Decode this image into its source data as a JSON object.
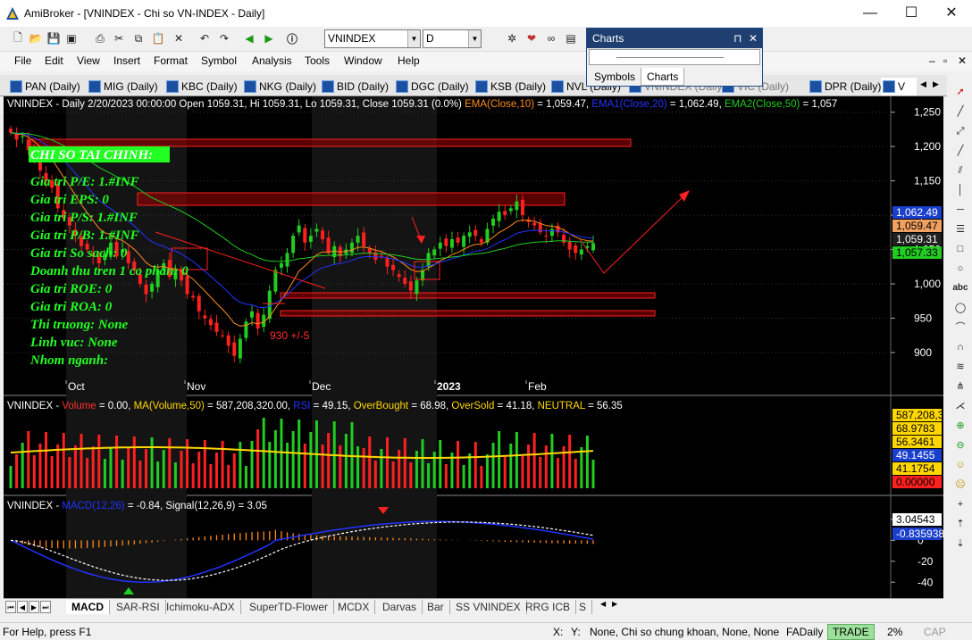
{
  "window": {
    "title": "AmiBroker - [VNINDEX - Chi so VN-INDEX - Daily]",
    "minimize": "—",
    "maximize": "☐",
    "close": "✕"
  },
  "toolbar": {
    "symbol": "VNINDEX",
    "interval": "D"
  },
  "menu": [
    "File",
    "Edit",
    "View",
    "Insert",
    "Format",
    "Symbol",
    "Analysis",
    "Tools",
    "Window",
    "Help"
  ],
  "mdi_controls": [
    "–",
    "▫",
    "✕"
  ],
  "chart_tabs": [
    "PAN (Daily)",
    "MIG (Daily)",
    "KBC (Daily)",
    "NKG (Daily)",
    "BID (Daily)",
    "DGC (Daily)",
    "KSB (Daily)",
    "NVL (Daily)",
    "VNINDEX (Daily)",
    "VIC (Daily)",
    "DPR (Daily)",
    "V"
  ],
  "charts_panel": {
    "title": "Charts",
    "pin": "⊓",
    "close": "✕",
    "tabs": [
      "Symbols",
      "Charts"
    ],
    "active_tab": "Charts"
  },
  "price_pane": {
    "header_segments": [
      {
        "text": "VNINDEX - Daily 2/20/2023 00:00:00 Open 1059.31, Hi 1059.31, Lo 1059.31, Close 1059.31 (0.0%) ",
        "color": "#ffffff"
      },
      {
        "text": "EMA(Close,10)",
        "color": "#ff8c1a"
      },
      {
        "text": " = 1,059.47, ",
        "color": "#ffffff"
      },
      {
        "text": "EMA1(Close,20)",
        "color": "#2233ff"
      },
      {
        "text": " = 1,062.49, ",
        "color": "#ffffff"
      },
      {
        "text": "EMA2(Close,50)",
        "color": "#22cc22"
      },
      {
        "text": " = 1,057",
        "color": "#ffffff"
      }
    ],
    "fundamentals_title": "CHI SO TAI CHINH:",
    "fundamentals": [
      "Gia tri P/E: 1.#INF",
      "Gia tri EPS: 0",
      "Gia tri P/S: 1.#INF",
      "Gia tri P/B: 1.#INF",
      "Gia tri So sach: 0",
      "Doanh thu tren 1 co phan: 0",
      "Gia tri ROE: 0",
      "Gia tri ROA: 0",
      "Thi truong: None",
      "Linh vuc: None",
      "Nhom nganh:"
    ],
    "annotation": "930 +/-5",
    "y_ticks": [
      "1,250",
      "1,200",
      "1,150",
      "1,100",
      "1,050",
      "1,000",
      "950",
      "900"
    ],
    "x_ticks": [
      "Oct",
      "Nov",
      "Dec",
      "2023",
      "Feb"
    ],
    "value_boxes": [
      {
        "text": "1,062.49",
        "bg": "#1a3fcc",
        "fg": "#ffffff"
      },
      {
        "text": "1,059.47",
        "bg": "#f0a060",
        "fg": "#000000"
      },
      {
        "text": "1,059.31",
        "bg": "#202020",
        "fg": "#ffffff"
      },
      {
        "text": "1,057.33",
        "bg": "#22cc22",
        "fg": "#000000"
      }
    ]
  },
  "volume_pane": {
    "header_segments": [
      {
        "text": "VNINDEX - ",
        "color": "#ffffff"
      },
      {
        "text": "Volume",
        "color": "#ff3030"
      },
      {
        "text": " = 0.00, ",
        "color": "#ffffff"
      },
      {
        "text": "MA(Volume,50)",
        "color": "#ffd700"
      },
      {
        "text": " = 587,208,320.00, ",
        "color": "#ffffff"
      },
      {
        "text": "RSI",
        "color": "#2233ff"
      },
      {
        "text": " = 49.15, ",
        "color": "#ffffff"
      },
      {
        "text": "OverBought",
        "color": "#ffd700"
      },
      {
        "text": " = 68.98, ",
        "color": "#ffffff"
      },
      {
        "text": "OverSold",
        "color": "#ffd700"
      },
      {
        "text": " = 41.18, ",
        "color": "#ffffff"
      },
      {
        "text": "NEUTRAL",
        "color": "#ffd700"
      },
      {
        "text": " = 56.35",
        "color": "#ffffff"
      }
    ],
    "value_boxes": [
      {
        "text": "587,208,3",
        "bg": "#ffd700",
        "fg": "#000000"
      },
      {
        "text": "68.9783",
        "bg": "#ffd700",
        "fg": "#000000"
      },
      {
        "text": "56.3461",
        "bg": "#ffd700",
        "fg": "#000000"
      },
      {
        "text": "49.1455",
        "bg": "#1a3fcc",
        "fg": "#ffffff"
      },
      {
        "text": "41.1754",
        "bg": "#ffd700",
        "fg": "#000000"
      },
      {
        "text": "0.00000",
        "bg": "#ff2020",
        "fg": "#000000"
      }
    ]
  },
  "macd_pane": {
    "header_segments": [
      {
        "text": "VNINDEX - ",
        "color": "#ffffff"
      },
      {
        "text": "MACD(12,26)",
        "color": "#2233ff"
      },
      {
        "text": " = -0.84, Signal(12,26,9) = 3.05",
        "color": "#ffffff"
      }
    ],
    "y_ticks": [
      "20",
      "0",
      "-20",
      "-40"
    ],
    "value_boxes": [
      {
        "text": "3.04543",
        "bg": "#ffffff",
        "fg": "#000000"
      },
      {
        "text": "-0.835938",
        "bg": "#1a3fcc",
        "fg": "#ffffff"
      }
    ]
  },
  "sheet_tabs": [
    "MACD",
    "SAR-RSI",
    "Ichimoku-ADX",
    "SuperTD-Flower",
    "MCDX",
    "Darvas",
    "Bar",
    "SS VNINDEX",
    "RRG ICB",
    "S"
  ],
  "active_sheet": "MACD",
  "status": {
    "help": "For Help, press F1",
    "x": "X:",
    "y": "Y:",
    "info": "None, Chi so chung khoan, None, None",
    "db": "FADaily",
    "mode": "TRADE",
    "pct": "2%",
    "cap": "CAP"
  },
  "colors": {
    "chart_bg": "#000000",
    "up_candle": "#22cc22",
    "down_candle": "#ff2020",
    "ema10": "#ff8c1a",
    "ema20": "#2233ff",
    "ema50": "#22cc22",
    "fund_text": "#22ff22",
    "grid": "#333333"
  },
  "chart_data": [
    {
      "type": "candlestick",
      "title": "VNINDEX - Daily",
      "x_ticks": [
        "Oct",
        "Nov",
        "Dec",
        "2023",
        "Feb"
      ],
      "ylim": [
        870,
        1260
      ],
      "close": [
        1220,
        1210,
        1215,
        1195,
        1180,
        1165,
        1150,
        1140,
        1110,
        1095,
        1085,
        1070,
        1055,
        1050,
        1040,
        1030,
        1045,
        1060,
        1040,
        1050,
        1030,
        1020,
        1000,
        985,
        1000,
        1020,
        1030,
        1010,
        1020,
        1005,
        985,
        980,
        960,
        950,
        940,
        930,
        925,
        910,
        895,
        920,
        945,
        960,
        935,
        955,
        990,
        1020,
        1030,
        1045,
        1070,
        1085,
        1060,
        1070,
        1080,
        1065,
        1045,
        1055,
        1040,
        1050,
        1060,
        1070,
        1055,
        1045,
        1035,
        1040,
        1025,
        1020,
        1010,
        1000,
        990,
        1005,
        1020,
        1045,
        1050,
        1060,
        1055,
        1065,
        1060,
        1070,
        1075,
        1070,
        1060,
        1080,
        1095,
        1105,
        1100,
        1110,
        1120,
        1100,
        1090,
        1085,
        1075,
        1070,
        1080,
        1075,
        1060,
        1050,
        1045,
        1050,
        1055,
        1059.31
      ],
      "series": [
        {
          "name": "EMA(Close,10)",
          "last": 1059.47
        },
        {
          "name": "EMA1(Close,20)",
          "last": 1062.49
        },
        {
          "name": "EMA2(Close,50)",
          "last": 1057.33
        }
      ]
    },
    {
      "type": "bar",
      "title": "Volume",
      "series": [
        {
          "name": "MA(Volume,50)",
          "last": 587208320
        }
      ]
    },
    {
      "type": "line",
      "title": "MACD",
      "ylim": [
        -50,
        25
      ],
      "series": [
        {
          "name": "MACD(12,26)",
          "last": -0.84
        },
        {
          "name": "Signal(12,26,9)",
          "last": 3.05
        }
      ]
    }
  ]
}
